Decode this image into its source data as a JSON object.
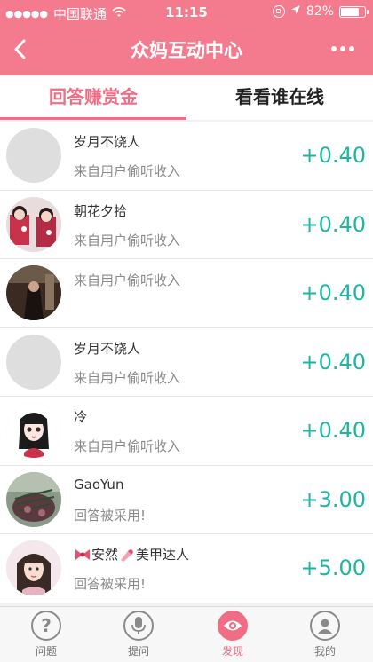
{
  "status_bar": {
    "carrier": "中国联通",
    "time": "11:15",
    "battery": "82%",
    "battery_level": 0.82
  },
  "navbar": {
    "title": "众妈互动中心",
    "back_icon": "chevron-left-icon",
    "more_icon": "more-dots-icon"
  },
  "tabs": [
    {
      "label": "回答赚赏金",
      "active": true
    },
    {
      "label": "看看谁在线",
      "active": false
    }
  ],
  "rows": [
    {
      "name": "岁月不饶人",
      "sub": "来自用户偷听收入",
      "amount": "+0.40",
      "avatar": "blank"
    },
    {
      "name": "朝花夕拾",
      "sub": "来自用户偷听收入",
      "amount": "+0.40",
      "avatar": "dolls"
    },
    {
      "name": "",
      "sub": "来自用户偷听收入",
      "amount": "+0.40",
      "avatar": "dark"
    },
    {
      "name": "岁月不饶人",
      "sub": "来自用户偷听收入",
      "amount": "+0.40",
      "avatar": "blank"
    },
    {
      "name": "冷",
      "sub": "来自用户偷听收入",
      "amount": "+0.40",
      "avatar": "girl"
    },
    {
      "name": "GaoYun",
      "sub": "回答被采用!",
      "amount": "+3.00",
      "avatar": "plant"
    },
    {
      "name_a": "安然",
      "name_b": "美甲达人",
      "sub": "回答被采用!",
      "amount": "+5.00",
      "avatar": "woman"
    }
  ],
  "tabbar": [
    {
      "label": "问题",
      "icon": "question-icon",
      "active": false
    },
    {
      "label": "提问",
      "icon": "microphone-icon",
      "active": false
    },
    {
      "label": "发现",
      "icon": "eye-icon",
      "active": true
    },
    {
      "label": "我的",
      "icon": "user-icon",
      "active": false
    }
  ],
  "colors": {
    "header": "#f47a8e",
    "accent": "#f06d86",
    "amount": "#1fb6a1"
  }
}
